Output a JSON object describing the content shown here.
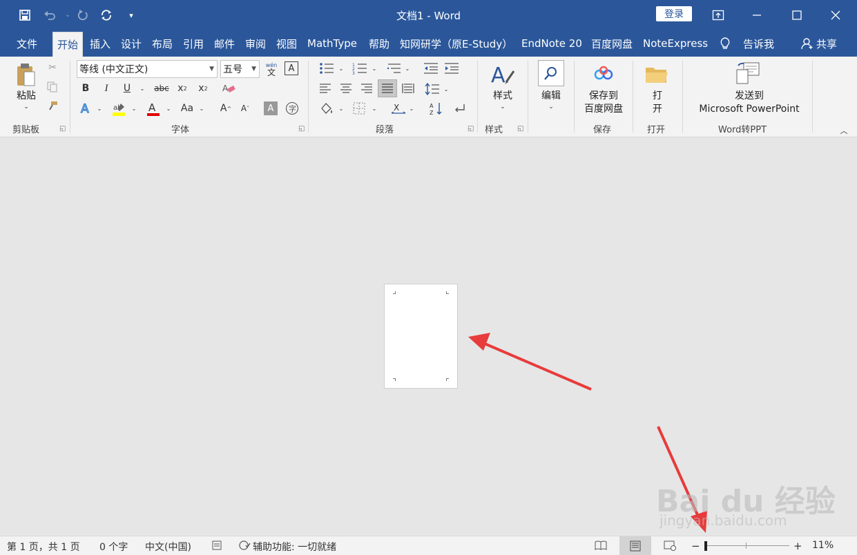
{
  "window": {
    "title": "文档1  -  Word",
    "login": "登录"
  },
  "quick_access": {
    "save": "save-icon",
    "undo": "undo-icon",
    "redo": "redo-icon",
    "sync": "sync-icon",
    "customize": "▾"
  },
  "tabs": [
    "文件",
    "开始",
    "插入",
    "设计",
    "布局",
    "引用",
    "邮件",
    "审阅",
    "视图",
    "MathType",
    "帮助",
    "知网研学（原E-Study）",
    "EndNote 20",
    "百度网盘",
    "NoteExpress",
    "告诉我",
    "共享"
  ],
  "ribbon": {
    "clipboard": {
      "paste": "粘贴",
      "label": "剪贴板"
    },
    "font": {
      "name": "等线 (中文正文)",
      "size": "五号",
      "phonetic": "wén",
      "label": "字体",
      "change_case": "Aa"
    },
    "paragraph": {
      "label": "段落"
    },
    "styles": {
      "button": "样式",
      "label": "样式"
    },
    "editing": {
      "button": "编辑"
    },
    "save": {
      "line1": "保存到",
      "line2": "百度网盘",
      "label": "保存"
    },
    "open": {
      "line1": "打",
      "line2": "开",
      "label": "打开"
    },
    "word2ppt": {
      "line1": "发送到",
      "line2": "Microsoft PowerPoint",
      "label": "Word转PPT"
    }
  },
  "status": {
    "page": "第 1 页，共 1 页",
    "words": "0 个字",
    "language": "中文(中国)",
    "accessibility": "辅助功能: 一切就绪",
    "zoom": "11%",
    "zoom_level_pct": 11
  },
  "watermark": {
    "brand": "Bai du 经验",
    "url": "jingyan.baidu.com"
  },
  "colors": {
    "brand": "#2b579a",
    "highlight": "#ffff00",
    "font_color": "#e00000",
    "arrow": "#e83b3b"
  }
}
